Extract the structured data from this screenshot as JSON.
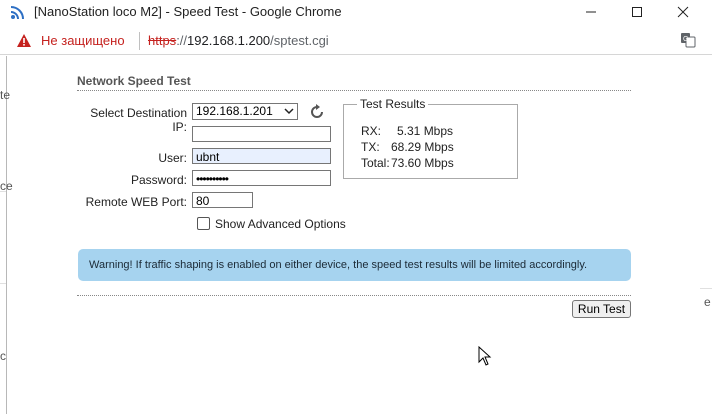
{
  "window": {
    "title": "[NanoStation loco M2] - Speed Test - Google Chrome",
    "minimize_icon": "minimize-icon",
    "maximize_icon": "maximize-icon",
    "close_icon": "close-icon"
  },
  "address_bar": {
    "security_label": "Не защищено",
    "url_scheme": "https",
    "url_rest": "://",
    "url_host": "192.168.1.200",
    "url_path": "/sptest.cgi"
  },
  "background_fragments": [
    "te",
    "ce",
    "c",
    "e"
  ],
  "form": {
    "section_title": "Network Speed Test",
    "dest_ip_label": "Select Destination IP:",
    "dest_ip_value": "192.168.1.201",
    "blank_field_value": "",
    "user_label": "User:",
    "user_value": "ubnt",
    "password_label": "Password:",
    "password_value": "••••••••••",
    "port_label": "Remote WEB Port:",
    "port_value": "80",
    "advanced_label": "Show Advanced Options",
    "advanced_checked": false
  },
  "results": {
    "legend": "Test Results",
    "rx_label": "RX:",
    "rx_value": "5.31 Mbps",
    "tx_label": "TX:",
    "tx_value": "68.29 Mbps",
    "total_label": "Total:",
    "total_value": "73.60 Mbps"
  },
  "warning": "Warning! If traffic shaping is enabled on either device, the speed test results will be limited accordingly.",
  "run_button": "Run Test",
  "colors": {
    "warning_bg": "#a6d3ef",
    "not_secure": "#c5221f",
    "autofill": "#e8f0fe"
  }
}
